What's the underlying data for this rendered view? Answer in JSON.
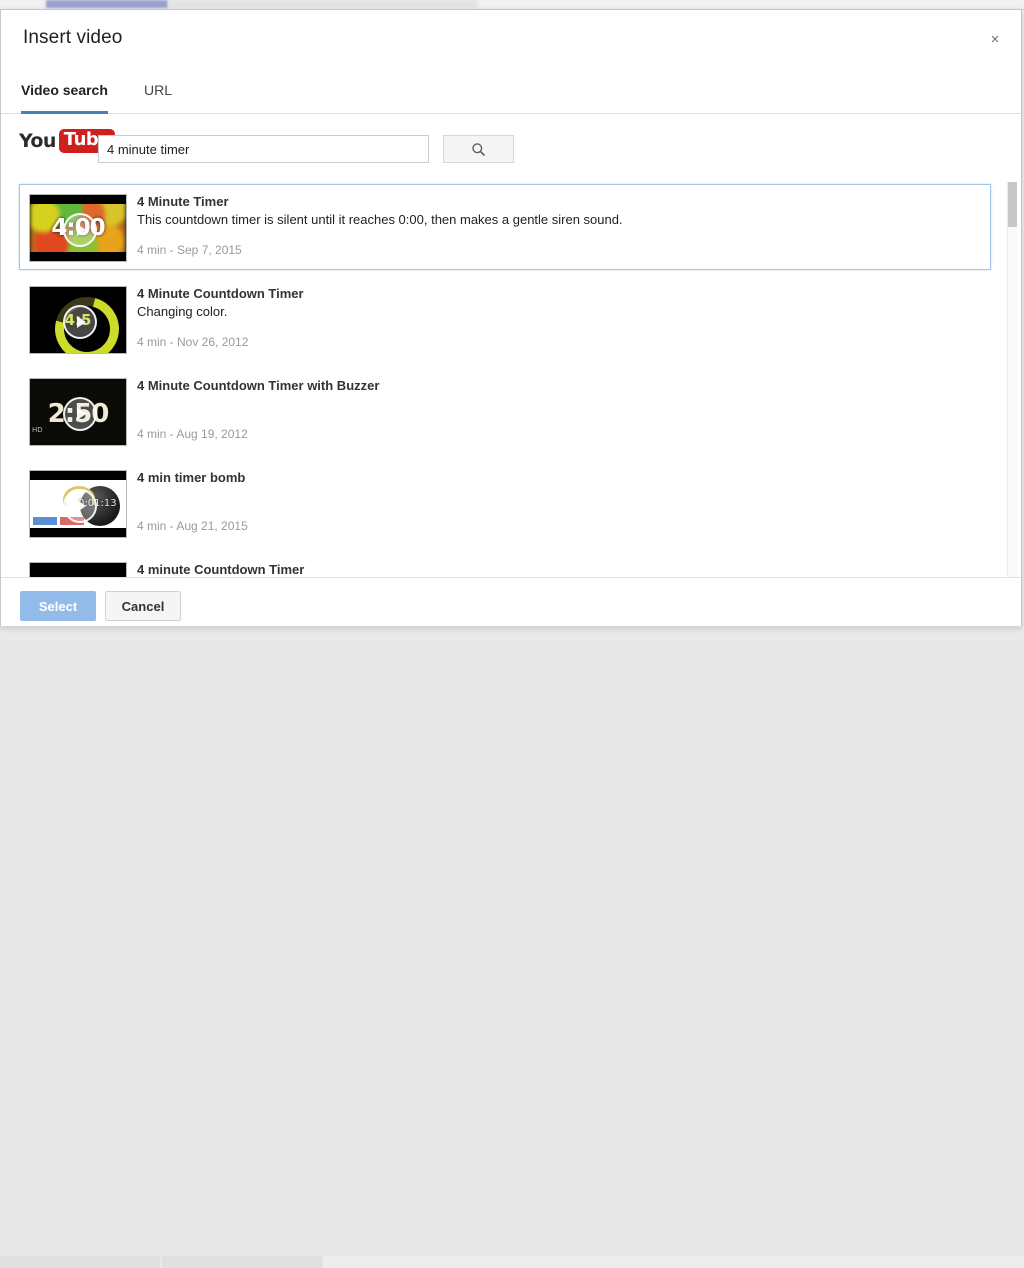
{
  "dialog": {
    "title": "Insert video",
    "close_label": "×"
  },
  "tabs": [
    {
      "label": "Video search",
      "active": true
    },
    {
      "label": "URL",
      "active": false
    }
  ],
  "search": {
    "brand_you": "You",
    "brand_tube": "Tube",
    "value": "4 minute timer",
    "placeholder": "",
    "button_icon": "search-icon"
  },
  "results": [
    {
      "title": "4 Minute Timer",
      "description": "This countdown timer is silent until it reaches 0:00, then makes a gentle siren sound.",
      "meta": "4 min - Sep 7, 2015",
      "thumb_text": "4:00",
      "selected": true
    },
    {
      "title": "4 Minute Countdown Timer",
      "description": "Changing color.",
      "meta": "4 min - Nov 26, 2012",
      "thumb_text": "4:5",
      "selected": false
    },
    {
      "title": "4 Minute Countdown Timer with Buzzer",
      "description": "",
      "meta": "4 min - Aug 19, 2012",
      "thumb_text": "2:50",
      "selected": false
    },
    {
      "title": "4 min timer bomb",
      "description": "",
      "meta": "4 min - Aug 21, 2015",
      "thumb_text": "0:01:13",
      "selected": false
    },
    {
      "title": "4 minute Countdown Timer",
      "description": "",
      "meta": "",
      "thumb_text": "",
      "selected": false
    }
  ],
  "footer": {
    "select_label": "Select",
    "cancel_label": "Cancel"
  },
  "colors": {
    "accent_blue": "#4a7ebb",
    "selected_border": "#a3c7e8",
    "youtube_red": "#cd201f",
    "select_button": "#93bbea"
  }
}
